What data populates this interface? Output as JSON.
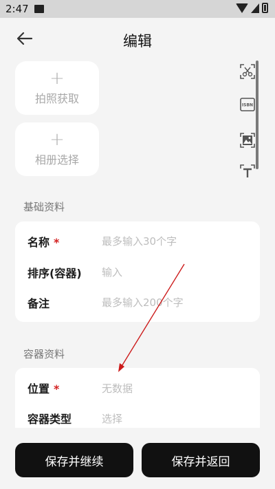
{
  "status_bar": {
    "time": "2:47"
  },
  "header": {
    "title": "编辑"
  },
  "photo_tiles": [
    {
      "plus": "+",
      "label": "拍照获取"
    },
    {
      "plus": "+",
      "label": "相册选择"
    }
  ],
  "side_tools": [
    {
      "icon": "scissors-icon"
    },
    {
      "icon": "isbn-icon",
      "text": "ISBN"
    },
    {
      "icon": "image-scan-icon"
    },
    {
      "icon": "text-scan-icon"
    }
  ],
  "sections": {
    "basic": {
      "title": "基础资料",
      "fields": [
        {
          "label": "名称",
          "required_mark": "*",
          "placeholder": "最多输入30个字"
        },
        {
          "label": "排序(容器)",
          "placeholder": "输入"
        },
        {
          "label": "备注",
          "placeholder": "最多输入200个字"
        }
      ]
    },
    "container": {
      "title": "容器资料",
      "fields": [
        {
          "label": "位置",
          "required_mark": "*",
          "value": "无数据"
        },
        {
          "label": "容器类型",
          "value": "选择"
        }
      ]
    }
  },
  "buttons": {
    "save_continue": "保存并继续",
    "save_return": "保存并返回"
  },
  "colors": {
    "accent_required": "#d32020",
    "button_bg": "#111111",
    "annotation_arrow": "#cc1a1a"
  }
}
